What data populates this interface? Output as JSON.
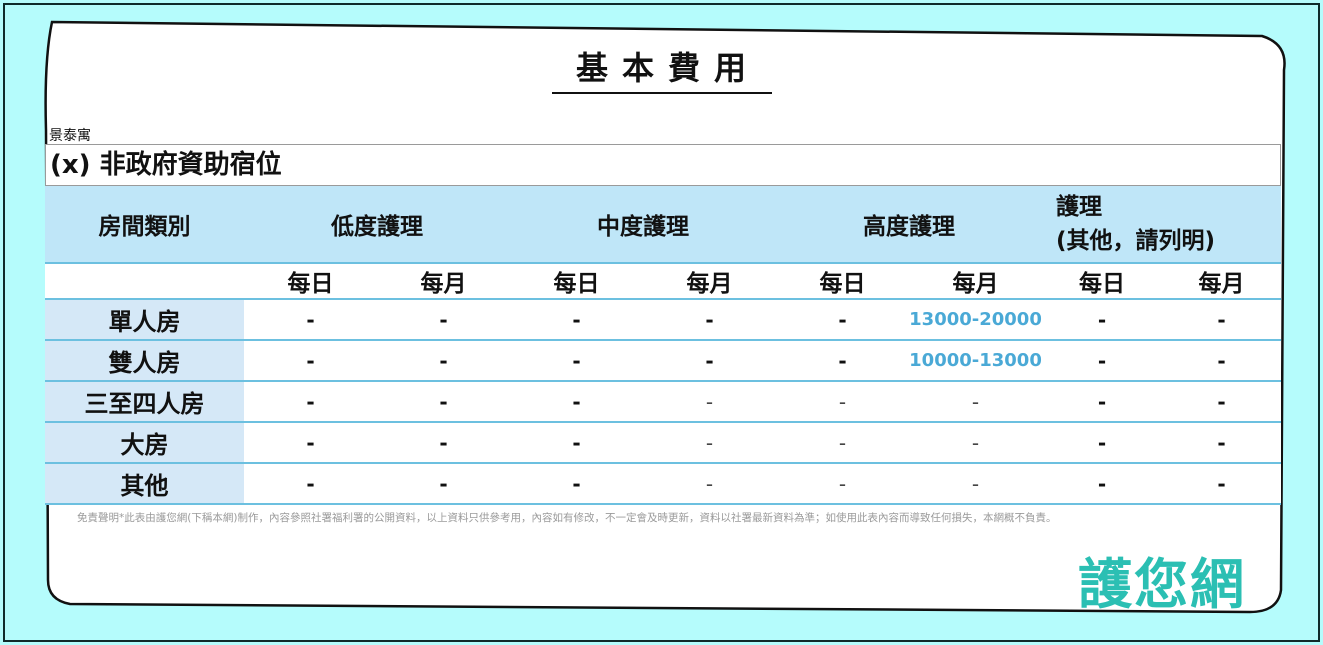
{
  "title": "基本費用",
  "subtitle": "景泰寓",
  "section_title": "(x) 非政府資助宿位",
  "table": {
    "headers": [
      "房間類別",
      "低度護理",
      "中度護理",
      "高度護理"
    ],
    "other_header_line1": "護理",
    "other_header_line2": "(其他，請列明)",
    "subheaders": [
      "每日",
      "每月",
      "每日",
      "每月",
      "每日",
      "每月",
      "每日",
      "每月"
    ],
    "rows": [
      {
        "label": "單人房",
        "cells": [
          "-",
          "-",
          "-",
          "-",
          "-",
          "13000-20000",
          "-",
          "-"
        ]
      },
      {
        "label": "雙人房",
        "cells": [
          "-",
          "-",
          "-",
          "-",
          "-",
          "10000-13000",
          "-",
          "-"
        ]
      },
      {
        "label": "三至四人房",
        "cells": [
          "-",
          "-",
          "-",
          "-",
          "-",
          "-",
          "-",
          "-"
        ]
      },
      {
        "label": "大房",
        "cells": [
          "-",
          "-",
          "-",
          "-",
          "-",
          "-",
          "-",
          "-"
        ]
      },
      {
        "label": "其他",
        "cells": [
          "-",
          "-",
          "-",
          "-",
          "-",
          "-",
          "-",
          "-"
        ]
      }
    ]
  },
  "disclaimer": "免責聲明*此表由護您網(下稱本網)制作，內容參照社署福利署的公開資料，以上資料只供參考用，內容如有修改，不一定會及時更新，資料以社署最新資料為準；如使用此表內容而導致任何損失，本網概不負責。",
  "logo": "護您網",
  "colors": {
    "background": "#b5fcfc",
    "header_fill": "#bfe6f8",
    "row_label_fill": "#d5e8f7",
    "grid_line": "#6cc0e0",
    "price_text": "#4aa9d6",
    "logo": "#2bbfb3"
  }
}
